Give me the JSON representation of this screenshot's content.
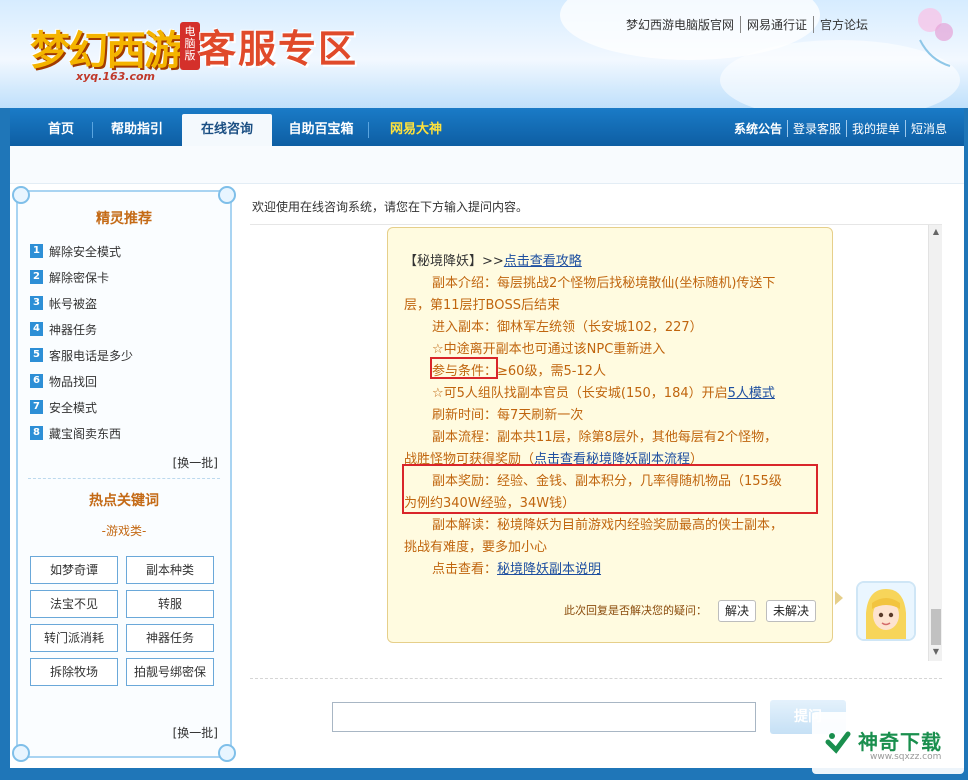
{
  "header": {
    "logo_text": "梦幻西游",
    "logo_badge": "电脑版",
    "logo_url": "xyq.163.com",
    "zone_title": "客服专区",
    "top_links": [
      "梦幻西游电脑版官网",
      "网易通行证",
      "官方论坛"
    ]
  },
  "nav": {
    "tabs": [
      {
        "label": "首页"
      },
      {
        "label": "帮助指引"
      },
      {
        "label": "在线咨询"
      },
      {
        "label": "自助百宝箱"
      },
      {
        "label": "网易大神"
      }
    ],
    "right_links": [
      "系统公告",
      "登录客服",
      "我的提单",
      "短消息"
    ]
  },
  "sidebar": {
    "rec_title": "精灵推荐",
    "rec_items": [
      {
        "num": "1",
        "label": "解除安全模式"
      },
      {
        "num": "2",
        "label": "解除密保卡"
      },
      {
        "num": "3",
        "label": "帐号被盗"
      },
      {
        "num": "4",
        "label": "神器任务"
      },
      {
        "num": "5",
        "label": "客服电话是多少"
      },
      {
        "num": "6",
        "label": "物品找回"
      },
      {
        "num": "7",
        "label": "安全模式"
      },
      {
        "num": "8",
        "label": "藏宝阁卖东西"
      }
    ],
    "refresh_label": "[换一批]",
    "kw_title": "热点关键词",
    "kw_sub": "-游戏类-",
    "keywords": [
      "如梦奇谭",
      "副本种类",
      "法宝不见",
      "转服",
      "转门派消耗",
      "神器任务",
      "拆除牧场",
      "拍靓号绑密保"
    ],
    "refresh_label_2": "[换一批]"
  },
  "chat": {
    "welcome": "欢迎使用在线咨询系统，请您在下方输入提问内容。",
    "lines": {
      "l1_prefix": "【秘境降妖】>>",
      "l1_link": "点击查看攻略",
      "l2": "副本介绍：每层挑战2个怪物后找秘境散仙(坐标随机)传送下",
      "l3": "层，第11层打BOSS后结束",
      "l4": "进入副本：御林军左统领（长安城102，227）",
      "l5": "☆中途离开副本也可通过该NPC重新进入",
      "l6_label": "参与条件：",
      "l6_value": "≥60级，需5-12人",
      "l7_prefix": "☆可5人组队找副本官员（长安城(150，184）开启",
      "l7_link": "5人模式",
      "l8": "刷新时间：每7天刷新一次",
      "l9": "副本流程：副本共11层，除第8层外，其他每层有2个怪物，",
      "l10_prefix": "战胜怪物可获得奖励（",
      "l10_link": "点击查看秘境降妖副本流程",
      "l10_suffix": "）",
      "l11": "副本奖励：经验、金钱、副本积分，几率得随机物品（155级",
      "l12": "为例约340W经验，34W钱）",
      "l13": "副本解读：秘境降妖为目前游戏内经验奖励最高的侠士副本，",
      "l14": "挑战有难度，要多加小心",
      "l15_prefix": "点击查看：",
      "l15_link": "秘境降妖副本说明"
    },
    "feedback_question": "此次回复是否解决您的疑问：",
    "btn_solved": "解决",
    "btn_unsolved": "未解决",
    "send_label": "提问"
  },
  "watermark": {
    "text": "神奇下载",
    "url": "www.sqxzz.com"
  },
  "colors": {
    "nav_blue": "#0e5ea3",
    "bubble_bg": "#fffbe0",
    "text_orange": "#c0650e",
    "highlight_red": "#d9252a"
  }
}
